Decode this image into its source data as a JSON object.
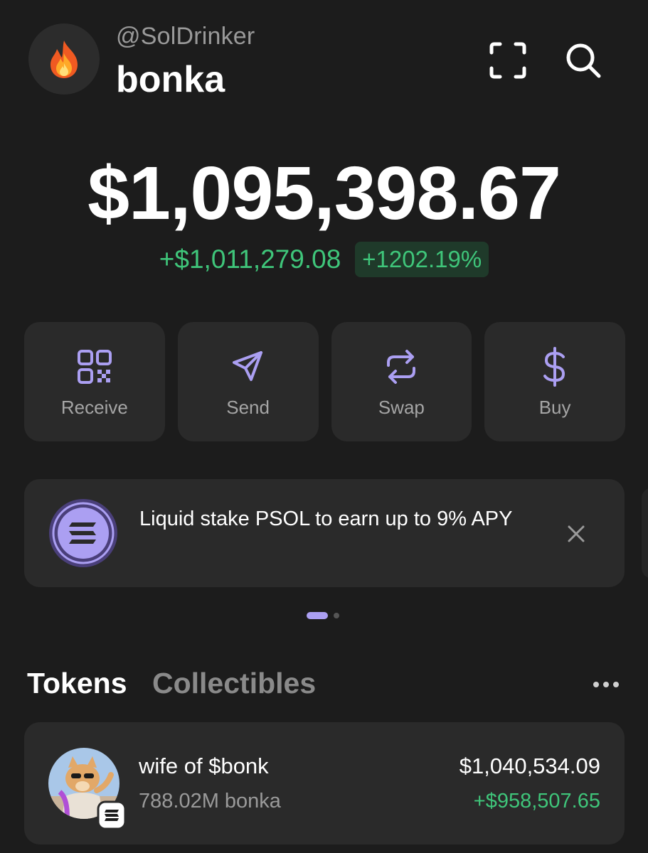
{
  "header": {
    "avatar_icon": "fire-emoji-icon",
    "handle": "@SolDrinker",
    "account_name": "bonka",
    "scan_icon": "scan-qr-icon",
    "search_icon": "search-icon"
  },
  "balance": {
    "total": "$1,095,398.67",
    "change_amount": "+$1,011,279.08",
    "change_percent": "+1202.19%"
  },
  "actions": [
    {
      "label": "Receive",
      "icon": "qr-code-icon"
    },
    {
      "label": "Send",
      "icon": "paper-plane-icon"
    },
    {
      "label": "Swap",
      "icon": "swap-arrows-icon"
    },
    {
      "label": "Buy",
      "icon": "dollar-icon"
    }
  ],
  "promo": {
    "icon": "solana-icon",
    "text": "Liquid stake PSOL to earn up to 9% APY",
    "close_icon": "close-icon",
    "page_index": 1,
    "page_count": 2
  },
  "tabs": {
    "tokens": "Tokens",
    "collectibles": "Collectibles",
    "active": "Tokens",
    "more_icon": "more-horizontal-icon"
  },
  "tokens": [
    {
      "name": "wife of $bonk",
      "amount": "788.02M bonka",
      "value": "$1,040,534.09",
      "change": "+$958,507.65",
      "chain_icon": "solana-icon"
    }
  ],
  "colors": {
    "background": "#1c1c1c",
    "card": "#2a2a2a",
    "accent": "#ab9ff2",
    "positive": "#3fc57a"
  }
}
